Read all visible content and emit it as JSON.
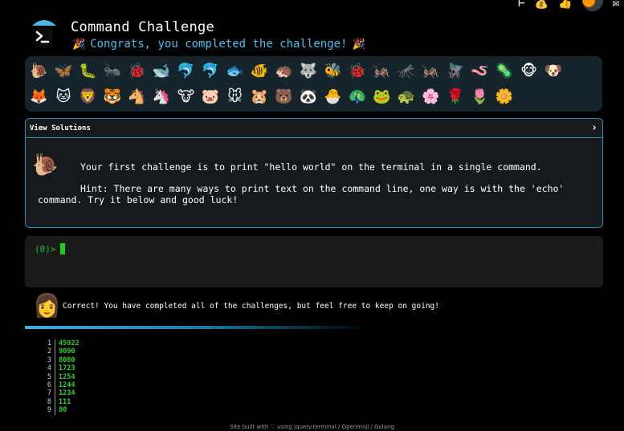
{
  "header": {
    "title": "Command Challenge",
    "congrats": "Congrats, you completed the challenge!",
    "party_icon": "🎉",
    "logo_icon": "terminal-logo-icon"
  },
  "top_icons": [
    "⊢",
    "💰",
    "👍",
    "🟠",
    "✉"
  ],
  "emoji_tray": [
    "🐌",
    "🦋",
    "🐛",
    "🐜",
    "🐞",
    "🐋",
    "🐬",
    "🐬",
    "🐟",
    "🐠",
    "🦔",
    "🐺",
    "🐝",
    "🐞",
    "🦗",
    "🦟",
    "🦗",
    "🪰",
    "🪱",
    "🦠",
    "🐵",
    "🐶",
    "🦊",
    "🐱",
    "🦁",
    "🐯",
    "🐴",
    "🦄",
    "🐮",
    "🐷",
    "🐭",
    "🐹",
    "🐻",
    "🐼",
    "🐣",
    "🦚",
    "🐸",
    "🐢",
    "🌸",
    "🌹",
    "🌷",
    "🌼"
  ],
  "panel": {
    "head_label": "View Solutions",
    "chevron": "›",
    "snail_icon": "🐌",
    "challenge": "Your first challenge is to print \"hello world\" on the terminal in a single command.",
    "hint": "Hint: There are many ways to print text on the command line, one way is with the 'echo' command. Try it below and good luck!"
  },
  "terminal": {
    "prompt": "(0)>"
  },
  "correct": {
    "avatar_icon": "👩",
    "message": "Correct! You have completed all of the challenges, but feel free to keep on going!"
  },
  "results": [
    {
      "n": "1",
      "v": "45922"
    },
    {
      "n": "2",
      "v": "9090"
    },
    {
      "n": "3",
      "v": "8080"
    },
    {
      "n": "4",
      "v": "1723"
    },
    {
      "n": "5",
      "v": "1254"
    },
    {
      "n": "6",
      "v": "1244"
    },
    {
      "n": "7",
      "v": "1234"
    },
    {
      "n": "8",
      "v": "111"
    },
    {
      "n": "9",
      "v": "80"
    }
  ],
  "footer": "Site built with ♡ using jquery.terminal / Openmoji / Golang",
  "colors": {
    "accent": "#46c3ee",
    "terminal_green": "#2fd12a",
    "panel_border": "#2b8fb3"
  }
}
